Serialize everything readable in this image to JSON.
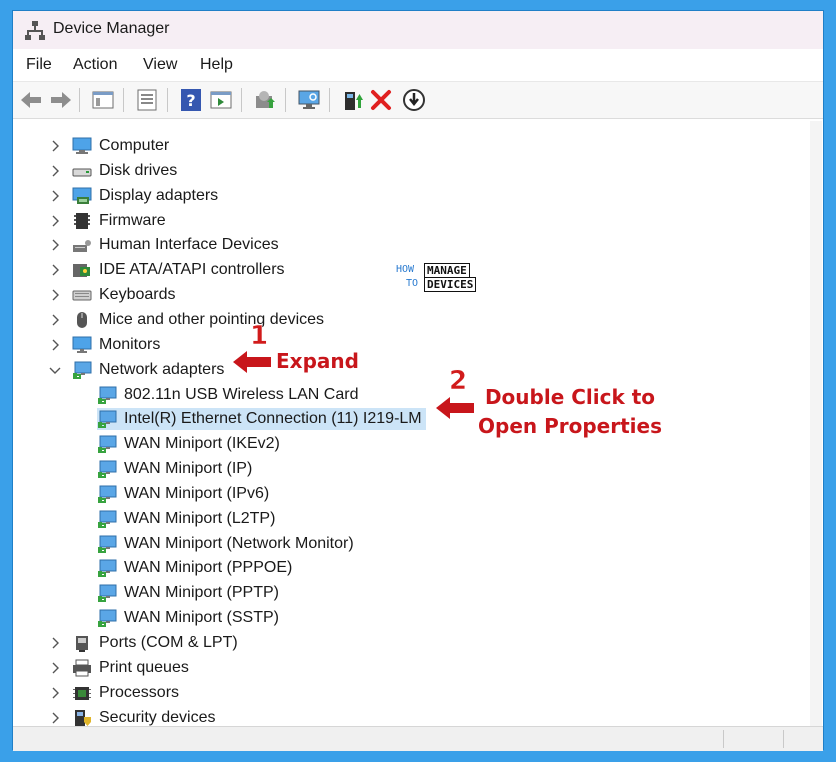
{
  "window": {
    "title": "Device Manager"
  },
  "menu": [
    "File",
    "Action",
    "View",
    "Help"
  ],
  "toolbar": {
    "icons": [
      "back-icon",
      "forward-icon",
      "console-tree-icon",
      "properties-icon",
      "help-icon",
      "action-pane-icon",
      "update-driver-icon",
      "monitor-icon",
      "enable-device-icon",
      "uninstall-device-icon",
      "disable-device-icon"
    ]
  },
  "tree": {
    "items": [
      {
        "label": "Computer",
        "icon": "computer-icon",
        "level": 0,
        "expanded": false
      },
      {
        "label": "Disk drives",
        "icon": "disk-drive-icon",
        "level": 0,
        "expanded": false
      },
      {
        "label": "Display adapters",
        "icon": "display-adapter-icon",
        "level": 0,
        "expanded": false
      },
      {
        "label": "Firmware",
        "icon": "firmware-icon",
        "level": 0,
        "expanded": false
      },
      {
        "label": "Human Interface Devices",
        "icon": "hid-icon",
        "level": 0,
        "expanded": false
      },
      {
        "label": "IDE ATA/ATAPI controllers",
        "icon": "ide-controller-icon",
        "level": 0,
        "expanded": false
      },
      {
        "label": "Keyboards",
        "icon": "keyboard-icon",
        "level": 0,
        "expanded": false
      },
      {
        "label": "Mice and other pointing devices",
        "icon": "mouse-icon",
        "level": 0,
        "expanded": false
      },
      {
        "label": "Monitors",
        "icon": "monitor-icon",
        "level": 0,
        "expanded": false
      },
      {
        "label": "Network adapters",
        "icon": "network-adapter-icon",
        "level": 0,
        "expanded": true
      },
      {
        "label": "802.11n USB Wireless LAN Card",
        "icon": "network-adapter-icon",
        "level": 1
      },
      {
        "label": "Intel(R) Ethernet Connection (11) I219-LM",
        "icon": "network-adapter-icon",
        "level": 1,
        "selected": true
      },
      {
        "label": "WAN Miniport (IKEv2)",
        "icon": "network-adapter-icon",
        "level": 1
      },
      {
        "label": "WAN Miniport (IP)",
        "icon": "network-adapter-icon",
        "level": 1
      },
      {
        "label": "WAN Miniport (IPv6)",
        "icon": "network-adapter-icon",
        "level": 1
      },
      {
        "label": "WAN Miniport (L2TP)",
        "icon": "network-adapter-icon",
        "level": 1
      },
      {
        "label": "WAN Miniport (Network Monitor)",
        "icon": "network-adapter-icon",
        "level": 1
      },
      {
        "label": "WAN Miniport (PPPOE)",
        "icon": "network-adapter-icon",
        "level": 1
      },
      {
        "label": "WAN Miniport (PPTP)",
        "icon": "network-adapter-icon",
        "level": 1
      },
      {
        "label": "WAN Miniport (SSTP)",
        "icon": "network-adapter-icon",
        "level": 1
      },
      {
        "label": "Ports (COM & LPT)",
        "icon": "port-icon",
        "level": 0,
        "expanded": false
      },
      {
        "label": "Print queues",
        "icon": "printer-icon",
        "level": 0,
        "expanded": false
      },
      {
        "label": "Processors",
        "icon": "processor-icon",
        "level": 0,
        "expanded": false
      },
      {
        "label": "Security devices",
        "icon": "security-device-icon",
        "level": 0,
        "expanded": false
      }
    ]
  },
  "annotations": {
    "step1_num": "1",
    "step1_text": "Expand",
    "step2_num": "2",
    "step2_line1": "Double Click to",
    "step2_line2": "Open Properties"
  },
  "logo": {
    "how": "HOW",
    "to": "TO",
    "manage": "MANAGE",
    "devices": "DEVICES"
  },
  "colors": {
    "frame": "#3aa0e9",
    "accent": "#c8161b",
    "selection": "#cce4f7",
    "titlebar": "#f6eef4"
  }
}
